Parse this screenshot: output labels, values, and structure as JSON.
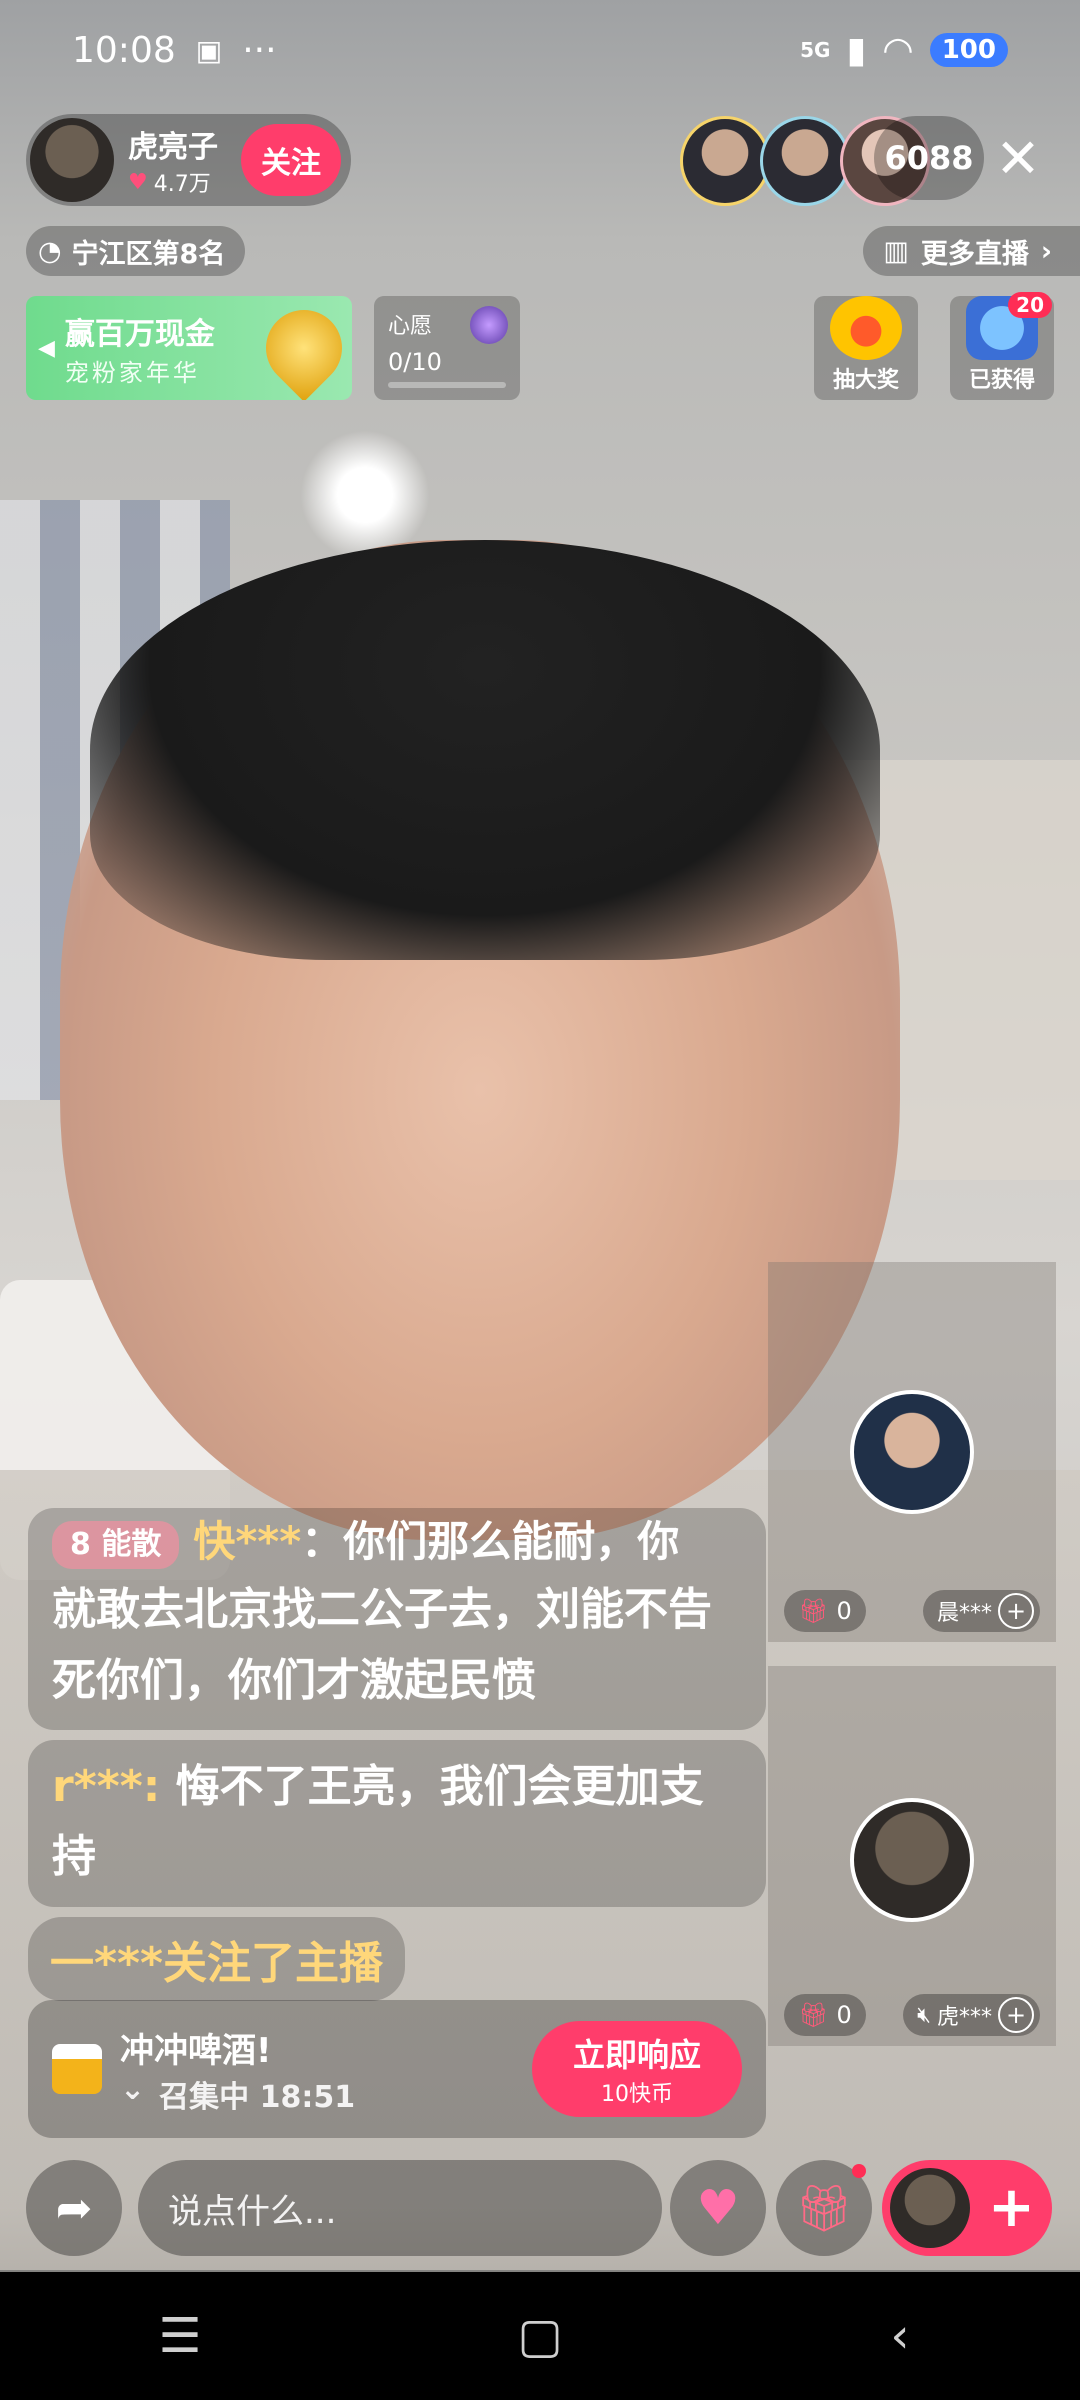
{
  "status_bar": {
    "time": "10:08",
    "more": "···",
    "network": "5G",
    "battery": "100"
  },
  "host": {
    "name": "虎亮子",
    "likes": "4.7万",
    "follow_label": "关注"
  },
  "viewer_count": "6088",
  "rank_label": "宁江区第8名",
  "more_live_label": "更多直播",
  "promo": {
    "title": "赢百万现金",
    "subtitle": "宠粉家年华"
  },
  "wish": {
    "label": "心愿",
    "count": "0/10"
  },
  "rewards": {
    "lottery_label": "抽大奖",
    "obtained_label": "已获得",
    "obtained_badge": "20"
  },
  "guests": [
    {
      "gift_count": "0",
      "name": "晨***"
    },
    {
      "gift_count": "0",
      "name": "虎***"
    }
  ],
  "chat": {
    "msg1_level": "8 能散",
    "msg1_user": "快***",
    "msg1_text_top": "：你们那么能耐，你",
    "msg1_text": "就敢去北京找二公子去，刘能不告死你们，你们才激起民愤",
    "msg2_user": "r***:",
    "msg2_text": "悔不了王亮，我们会更加支持",
    "join_text": "一***关注了主播"
  },
  "task": {
    "title": "冲冲啤酒!",
    "status": "召集中 18:51",
    "respond_label": "立即响应",
    "respond_price": "10快币"
  },
  "input": {
    "placeholder": "说点什么..."
  },
  "colors": {
    "accent": "#ff3d6b",
    "promo_green": "#6fdb8d",
    "username_gold": "#ffd77a"
  }
}
